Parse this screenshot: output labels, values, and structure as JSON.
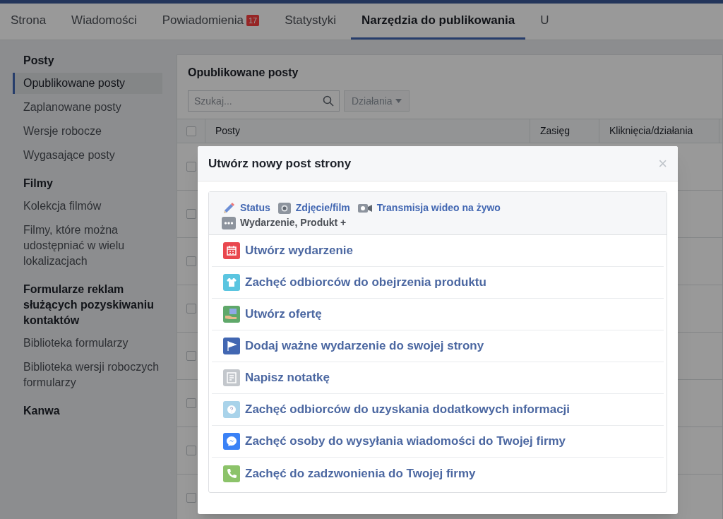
{
  "tabs": [
    {
      "label": "Strona",
      "selected": false
    },
    {
      "label": "Wiadomości",
      "selected": false
    },
    {
      "label": "Powiadomienia",
      "selected": false,
      "badge": "17"
    },
    {
      "label": "Statystyki",
      "selected": false
    },
    {
      "label": "Narzędzia do publikowania",
      "selected": true
    },
    {
      "label": "U",
      "selected": false
    }
  ],
  "sidebar": [
    {
      "title": "Posty",
      "items": [
        {
          "label": "Opublikowane posty",
          "selected": true
        },
        {
          "label": "Zaplanowane posty",
          "selected": false
        },
        {
          "label": "Wersje robocze",
          "selected": false
        },
        {
          "label": "Wygasające posty",
          "selected": false
        }
      ]
    },
    {
      "title": "Filmy",
      "items": [
        {
          "label": "Kolekcja filmów",
          "selected": false
        },
        {
          "label": "Filmy, które można udostępniać w wielu lokalizacjach",
          "selected": false
        }
      ]
    },
    {
      "title": "Formularze reklam służących pozyskiwaniu kontaktów",
      "items": [
        {
          "label": "Biblioteka formularzy",
          "selected": false
        },
        {
          "label": "Biblioteka wersji roboczych formularzy",
          "selected": false
        }
      ]
    },
    {
      "title": "Kanwa"
    }
  ],
  "panel": {
    "title": "Opublikowane posty",
    "search": {
      "placeholder": "Szukaj..."
    },
    "actions": {
      "label": "Działania",
      "disabled": true
    },
    "select_all": {
      "checked": false
    },
    "columns": [
      "Posty",
      "Zasięg",
      "Kliknięcia/działania"
    ],
    "rows": [
      {
        "checked": false
      },
      {
        "checked": false
      },
      {
        "checked": false
      },
      {
        "checked": false
      },
      {
        "checked": false
      },
      {
        "checked": false
      },
      {
        "checked": false
      },
      {
        "checked": false
      }
    ]
  },
  "dialog": {
    "title": "Utwórz nowy post strony",
    "close": "×",
    "composer": [
      {
        "label": "Status",
        "kind": "pencil"
      },
      {
        "label": "Zdjęcie/film",
        "kind": "camera"
      },
      {
        "label": "Transmisja wideo na żywo",
        "kind": "video"
      }
    ],
    "more": {
      "label": "Wydarzenie, Produkt +",
      "selected": true
    },
    "options": [
      {
        "label": "Utwórz wydarzenie",
        "kind": "calendar",
        "color": "#e9474e"
      },
      {
        "label": "Zachęć odbiorców do obejrzenia produktu",
        "kind": "shirt",
        "color": "#5bc5e0"
      },
      {
        "label": "Utwórz ofertę",
        "kind": "offer",
        "color": "#5fa86a"
      },
      {
        "label": "Dodaj ważne wydarzenie do swojej strony",
        "kind": "flag",
        "color": "#4267b2"
      },
      {
        "label": "Napisz notatkę",
        "kind": "note",
        "color": "#c3c7cc"
      },
      {
        "label": "Zachęć odbiorców do uzyskania dodatkowych informacji",
        "kind": "question",
        "color": "#a9d3ea"
      },
      {
        "label": "Zachęć osoby do wysyłania wiadomości do Twojej firmy",
        "kind": "messenger",
        "color": "#3b82f6"
      },
      {
        "label": "Zachęć do zadzwonienia do Twojej firmy",
        "kind": "phone",
        "color": "#8cc36a"
      }
    ]
  }
}
